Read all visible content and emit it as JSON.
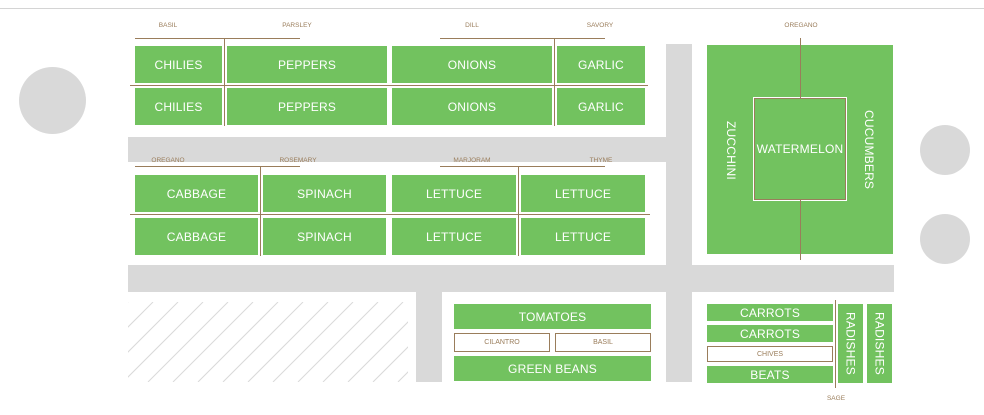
{
  "colors": {
    "bed": "#72c25f",
    "path": "#d9d9d9",
    "herb": "#9a7d5b",
    "background": "#ffffff"
  },
  "herbs": {
    "basil_top": "BASIL",
    "parsley": "PARSLEY",
    "dill": "DILL",
    "savory": "SAVORY",
    "oregano_right": "OREGANO",
    "oregano_left": "OREGANO",
    "rosemary": "ROSEMARY",
    "marjoram": "MARJORAM",
    "thyme": "THYME",
    "cilantro": "CILANTRO",
    "basil_bottom": "BASIL",
    "chives": "CHIVES",
    "sage": "SAGE"
  },
  "beds": {
    "row1": [
      "CHILIES",
      "PEPPERS",
      "ONIONS",
      "GARLIC"
    ],
    "row2": [
      "CHILIES",
      "PEPPERS",
      "ONIONS",
      "GARLIC"
    ],
    "row3": [
      "CABBAGE",
      "SPINACH",
      "LETTUCE",
      "LETTUCE"
    ],
    "row4": [
      "CABBAGE",
      "SPINACH",
      "LETTUCE",
      "LETTUCE"
    ],
    "right": {
      "left": "ZUCCHINI",
      "center": "WATERMELON",
      "right": "CUCUMBERS"
    },
    "middle": {
      "top": "TOMATOES",
      "bottom": "GREEN BEANS"
    },
    "corner": {
      "carrots1": "CARROTS",
      "carrots2": "CARROTS",
      "beats": "BEATS",
      "radishes1": "RADISHES",
      "radishes2": "RADISHES"
    }
  }
}
